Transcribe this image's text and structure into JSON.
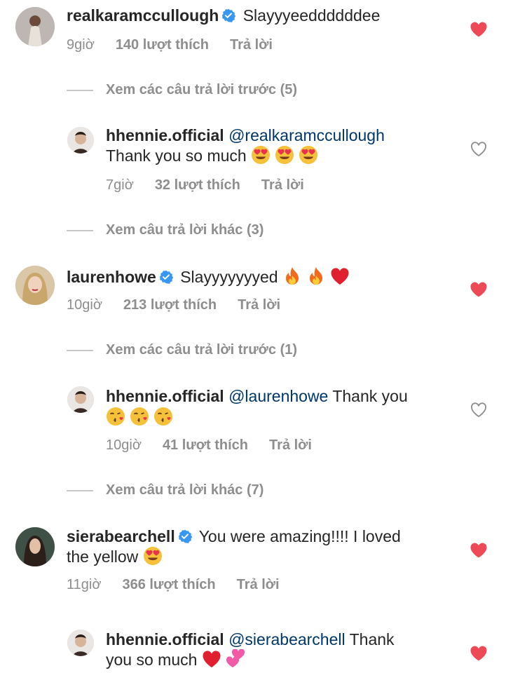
{
  "comments": [
    {
      "username": "realkaramccullough",
      "verified": true,
      "text": "Slayyyeeddddddee",
      "time": "9giờ",
      "likes": "140 lượt thích",
      "reply_label": "Trả lời",
      "liked": true
    },
    {
      "view_more": "Xem các câu trả lời trước (5)"
    },
    {
      "username": "hhennie.official",
      "mention": "@realkaramccullough",
      "text": "Thank you so much",
      "emojis": [
        "heart-eyes-emoji",
        "heart-eyes-emoji",
        "heart-eyes-emoji"
      ],
      "time": "7giờ",
      "likes": "32 lượt thích",
      "reply_label": "Trả lời",
      "liked": false
    },
    {
      "view_more": "Xem câu trả lời khác (3)"
    },
    {
      "username": "laurenhowe",
      "verified": true,
      "text": "Slayyyyyyyed",
      "emojis": [
        "fire-emoji",
        "fire-emoji",
        "red-heart-emoji"
      ],
      "time": "10giờ",
      "likes": "213 lượt thích",
      "reply_label": "Trả lời",
      "liked": true
    },
    {
      "view_more": "Xem các câu trả lời trước (1)"
    },
    {
      "username": "hhennie.official",
      "mention": "@laurenhowe",
      "text": "Thank you",
      "emojis": [
        "kissing-heart-emoji",
        "kissing-heart-emoji",
        "kissing-heart-emoji"
      ],
      "time": "10giờ",
      "likes": "41 lượt thích",
      "reply_label": "Trả lời",
      "liked": false
    },
    {
      "view_more": "Xem câu trả lời khác (7)"
    },
    {
      "username": "sierabearchell",
      "verified": true,
      "text": "You were amazing!!!! I loved",
      "text_line2": "the yellow",
      "emojis": [
        "heart-eyes-emoji"
      ],
      "time": "11giờ",
      "likes": "366 lượt thích",
      "reply_label": "Trả lời",
      "liked": true
    },
    {
      "username": "hhennie.official",
      "mention": "@sierabearchell",
      "text": "Thank",
      "text_line2": "you so much",
      "emojis": [
        "red-heart-emoji",
        "two-hearts-emoji"
      ],
      "liked": true
    }
  ],
  "colors": {
    "like_red": "#ed4956",
    "meta_gray": "#8e8e8e",
    "text": "#262626",
    "mention_blue": "#00376b",
    "verified_blue": "#3897f0"
  }
}
